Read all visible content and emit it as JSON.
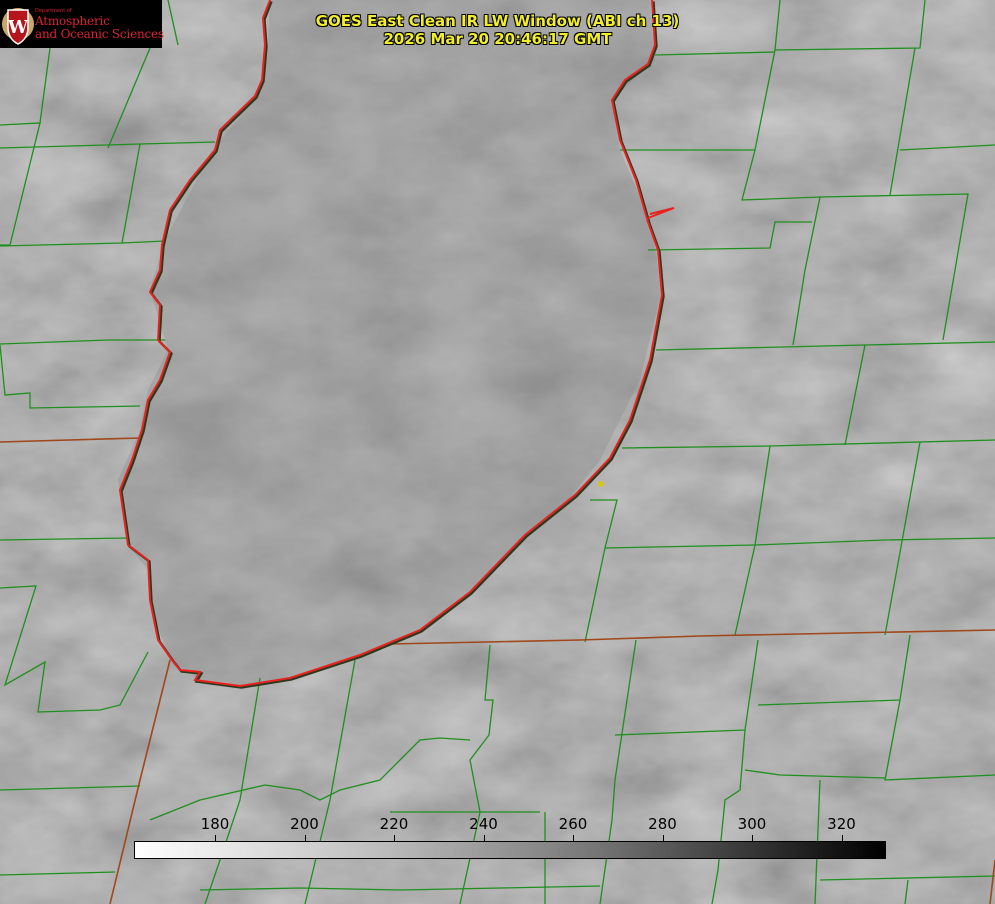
{
  "logo": {
    "department": "Department of",
    "line1": "Atmospheric",
    "line2": "and Oceanic Sciences",
    "shield_letter": "W",
    "color": "#d9232f"
  },
  "title": {
    "line1": "GOES East Clean IR LW Window (ABI ch 13)",
    "line2": "2026 Mar 20 20:46:17 GMT",
    "color": "#f2ee2a"
  },
  "colorbar": {
    "ticks": [
      "180",
      "200",
      "220",
      "240",
      "260",
      "280",
      "300",
      "320"
    ],
    "gradient": "white-to-black"
  },
  "map": {
    "lake_outline_color": "#e8221e",
    "county_line_color": "#1f8f1f",
    "state_line_color": "#a0471b",
    "marker_color": "#d9c21a"
  }
}
